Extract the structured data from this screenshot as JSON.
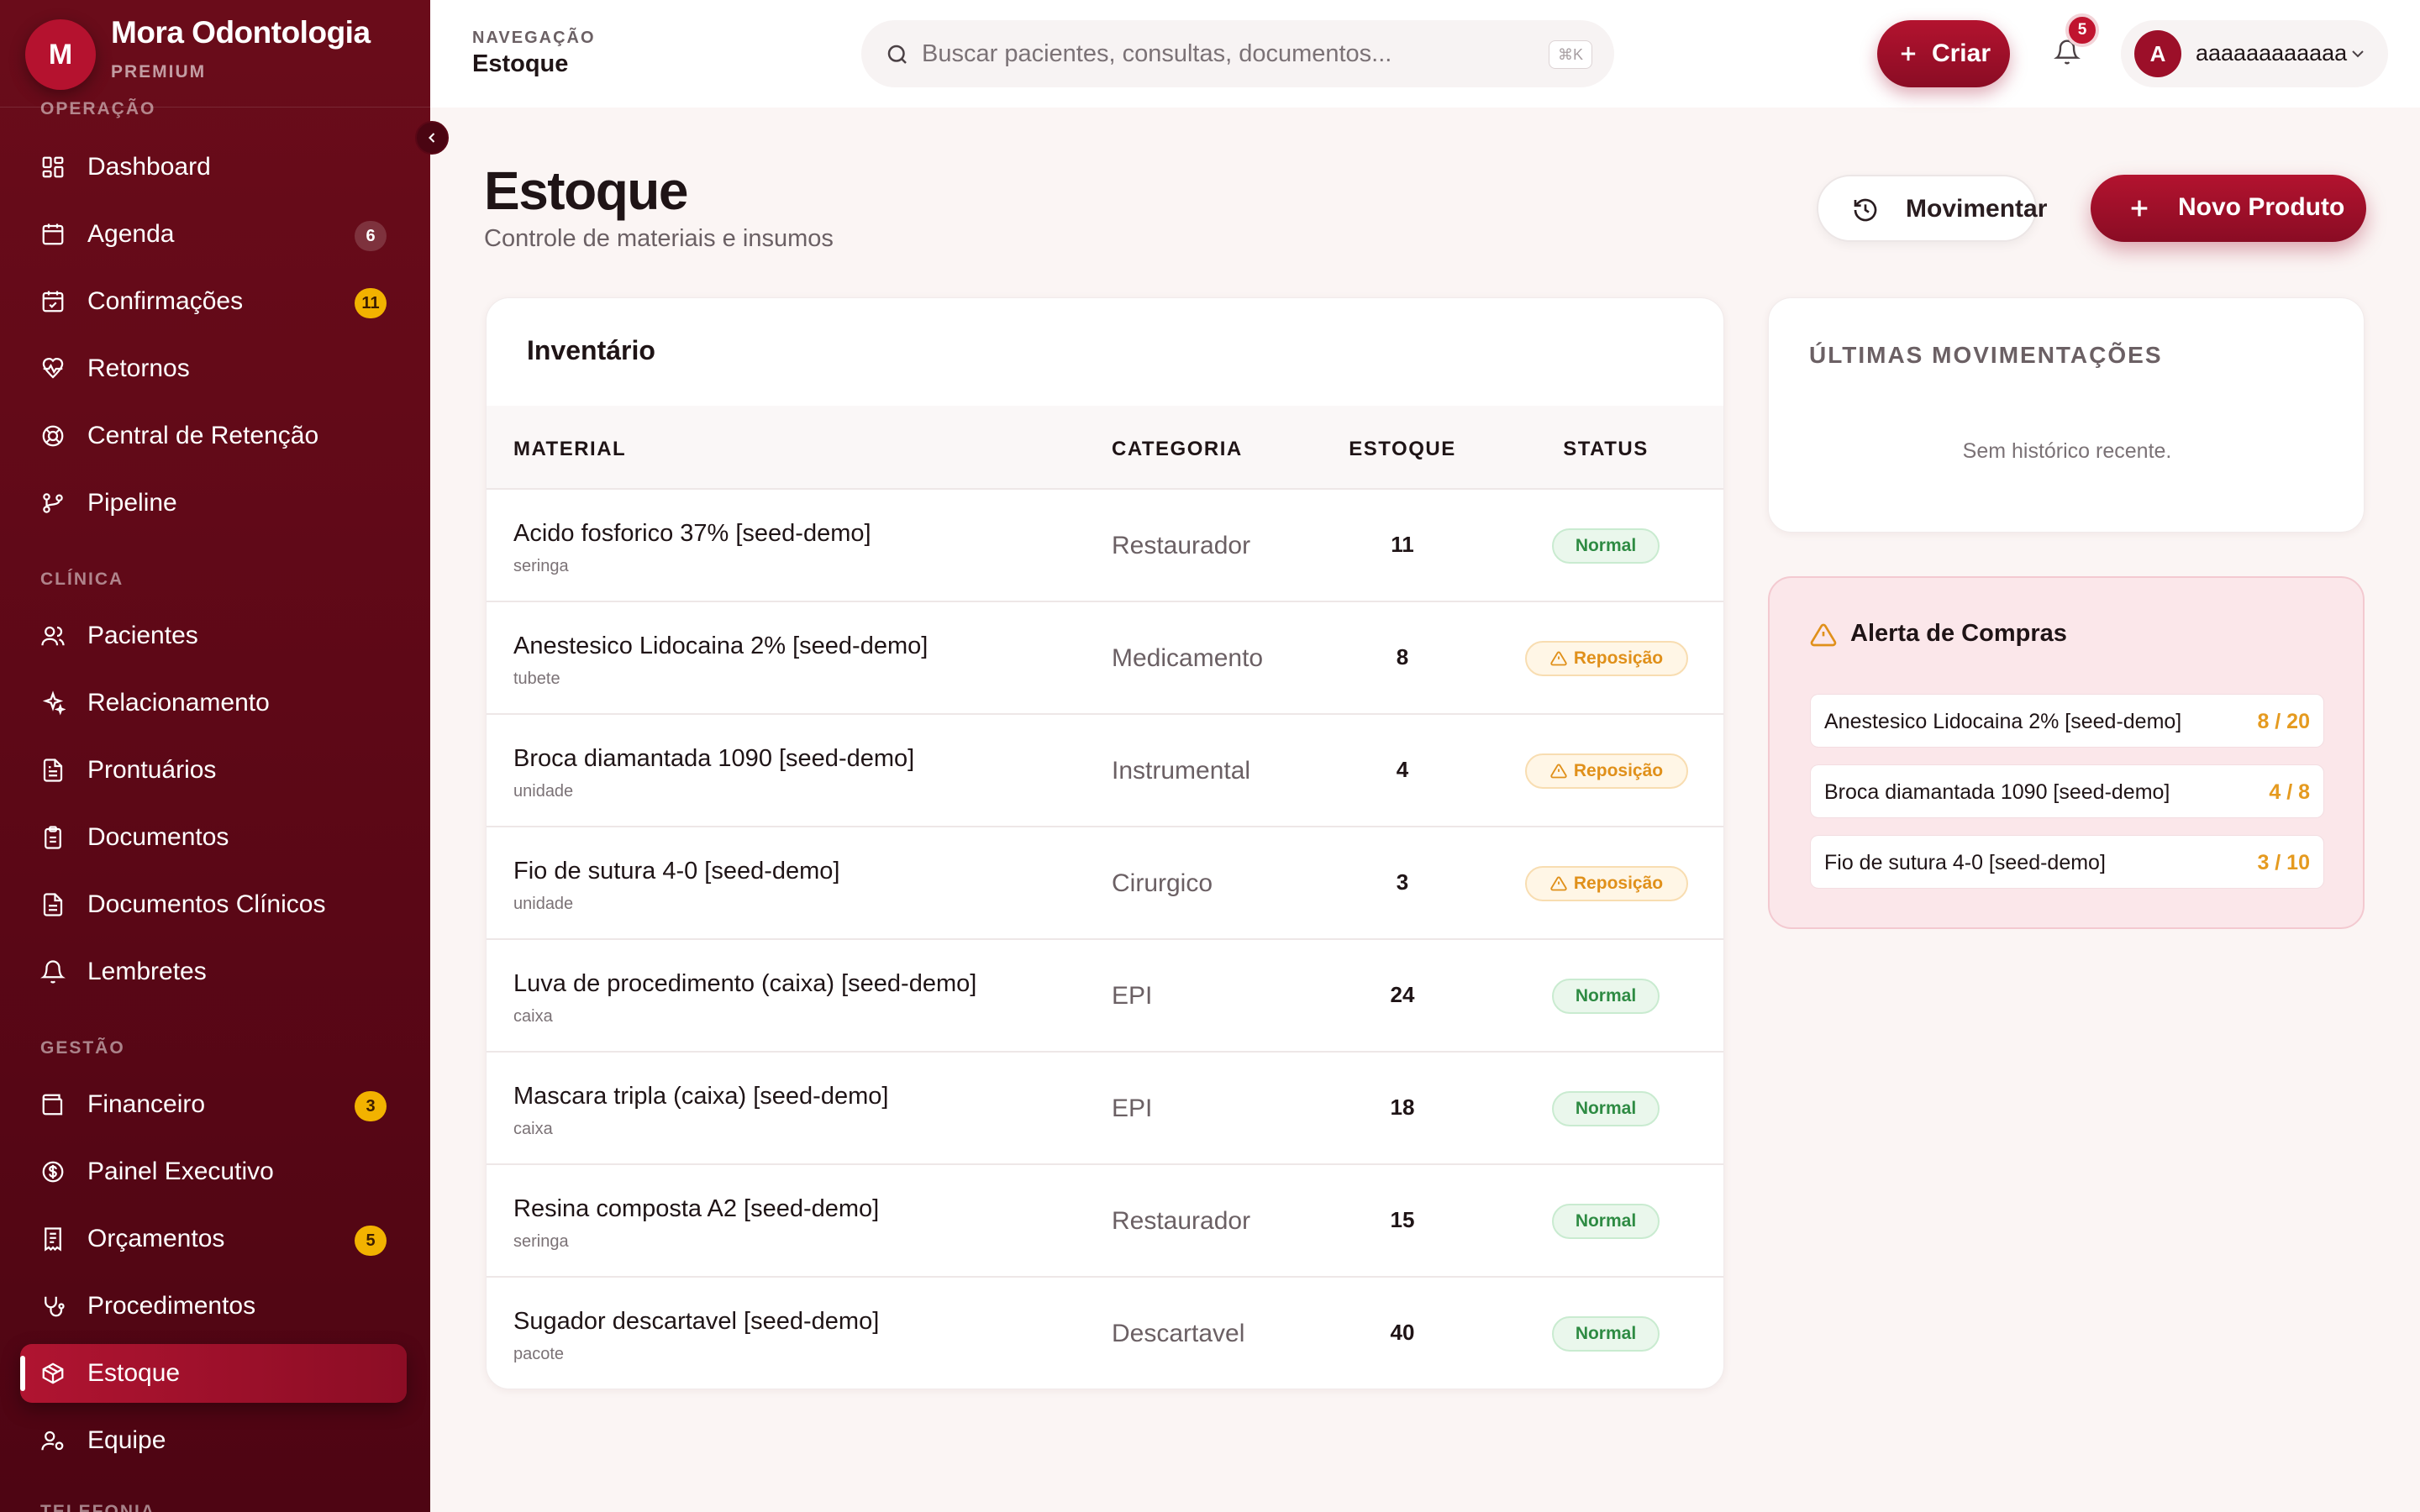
{
  "brand": {
    "initial": "M",
    "name": "Mora Odontologia",
    "tier": "PREMIUM"
  },
  "sidebar": {
    "sections": [
      {
        "label": "OPERAÇÃO"
      },
      {
        "label": "CLÍNICA"
      },
      {
        "label": "GESTÃO"
      },
      {
        "label": "TELEFONIA"
      }
    ],
    "items": [
      {
        "label": "Dashboard",
        "icon": "dashboard-icon"
      },
      {
        "label": "Agenda",
        "icon": "calendar-icon",
        "badge": "6"
      },
      {
        "label": "Confirmações",
        "icon": "calendar-check-icon",
        "badge": "11"
      },
      {
        "label": "Retornos",
        "icon": "heart-pulse-icon"
      },
      {
        "label": "Central de Retenção",
        "icon": "lifebuoy-icon"
      },
      {
        "label": "Pipeline",
        "icon": "git-branch-icon"
      },
      {
        "label": "Pacientes",
        "icon": "users-icon"
      },
      {
        "label": "Relacionamento",
        "icon": "sparkles-icon"
      },
      {
        "label": "Prontuários",
        "icon": "file-text-icon"
      },
      {
        "label": "Documentos",
        "icon": "clipboard-icon"
      },
      {
        "label": "Documentos Clínicos",
        "icon": "file-medical-icon"
      },
      {
        "label": "Lembretes",
        "icon": "bell-icon"
      },
      {
        "label": "Financeiro",
        "icon": "wallet-icon",
        "badge": "3"
      },
      {
        "label": "Painel Executivo",
        "icon": "dollar-circle-icon"
      },
      {
        "label": "Orçamentos",
        "icon": "receipt-icon",
        "badge": "5"
      },
      {
        "label": "Procedimentos",
        "icon": "stethoscope-icon"
      },
      {
        "label": "Estoque",
        "icon": "package-icon",
        "active": true
      },
      {
        "label": "Equipe",
        "icon": "user-cog-icon"
      }
    ]
  },
  "topbar": {
    "crumb_label": "NAVEGAÇÃO",
    "crumb_title": "Estoque",
    "search_placeholder": "Buscar pacientes, consultas, documentos...",
    "search_shortcut": "⌘K",
    "create_label": "Criar",
    "notifications_count": "5",
    "user_initial": "A",
    "user_name": "aaaaaaaaaaaa"
  },
  "page": {
    "title": "Estoque",
    "subtitle": "Controle de materiais e insumos",
    "move_label": "Movimentar",
    "new_label": "Novo Produto"
  },
  "inventory": {
    "title": "Inventário",
    "columns": [
      "MATERIAL",
      "CATEGORIA",
      "ESTOQUE",
      "STATUS"
    ],
    "rows": [
      {
        "name": "Acido fosforico 37% [seed-demo]",
        "unit": "seringa",
        "category": "Restaurador",
        "qty": "11",
        "status": "Normal",
        "status_type": "ok"
      },
      {
        "name": "Anestesico Lidocaina 2% [seed-demo]",
        "unit": "tubete",
        "category": "Medicamento",
        "qty": "8",
        "status": "Reposição",
        "status_type": "warn"
      },
      {
        "name": "Broca diamantada 1090 [seed-demo]",
        "unit": "unidade",
        "category": "Instrumental",
        "qty": "4",
        "status": "Reposição",
        "status_type": "warn"
      },
      {
        "name": "Fio de sutura 4-0 [seed-demo]",
        "unit": "unidade",
        "category": "Cirurgico",
        "qty": "3",
        "status": "Reposição",
        "status_type": "warn"
      },
      {
        "name": "Luva de procedimento (caixa) [seed-demo]",
        "unit": "caixa",
        "category": "EPI",
        "qty": "24",
        "status": "Normal",
        "status_type": "ok"
      },
      {
        "name": "Mascara tripla (caixa) [seed-demo]",
        "unit": "caixa",
        "category": "EPI",
        "qty": "18",
        "status": "Normal",
        "status_type": "ok"
      },
      {
        "name": "Resina composta A2 [seed-demo]",
        "unit": "seringa",
        "category": "Restaurador",
        "qty": "15",
        "status": "Normal",
        "status_type": "ok"
      },
      {
        "name": "Sugador descartavel [seed-demo]",
        "unit": "pacote",
        "category": "Descartavel",
        "qty": "40",
        "status": "Normal",
        "status_type": "ok"
      }
    ]
  },
  "movements": {
    "title": "ÚLTIMAS MOVIMENTAÇÕES",
    "empty": "Sem histórico recente."
  },
  "alerts": {
    "title": "Alerta de Compras",
    "items": [
      {
        "name": "Anestesico Lidocaina 2% [seed-demo]",
        "qty": "8 / 20"
      },
      {
        "name": "Broca diamantada 1090 [seed-demo]",
        "qty": "4 / 8"
      },
      {
        "name": "Fio de sutura 4-0 [seed-demo]",
        "qty": "3 / 10"
      }
    ]
  },
  "colors": {
    "brand": "#8a0c24",
    "sidebar": "#5a0716",
    "ok": "#2e8b43",
    "warn": "#e0901a"
  }
}
